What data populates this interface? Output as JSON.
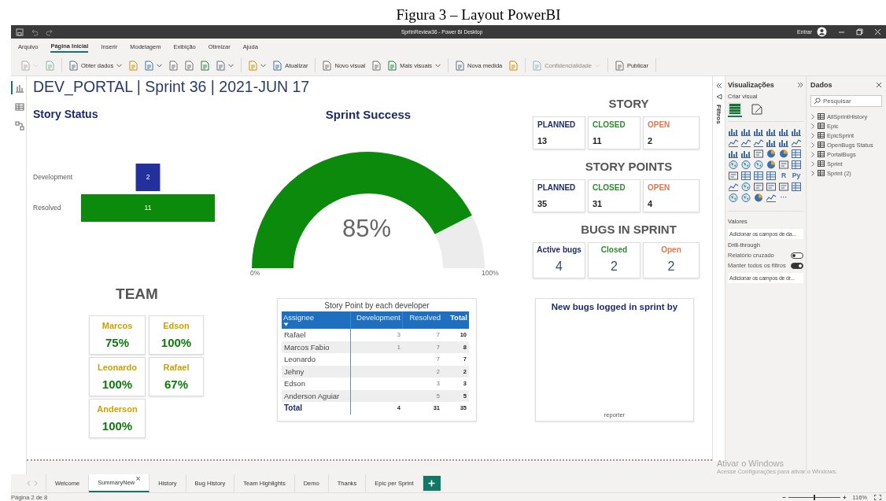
{
  "caption": "Figura 3 – Layout PowerBI",
  "window": {
    "title": "SpritnReview36 - Power BI Desktop",
    "sign_in": "Entrar"
  },
  "ribbon_tabs": [
    {
      "label": "Arquivo",
      "selected": false
    },
    {
      "label": "Página Inicial",
      "selected": true
    },
    {
      "label": "Inserir",
      "selected": false
    },
    {
      "label": "Modelagem",
      "selected": false
    },
    {
      "label": "Exibição",
      "selected": false
    },
    {
      "label": "Otimizar",
      "selected": false
    },
    {
      "label": "Ajuda",
      "selected": false
    }
  ],
  "toolbar": [
    [
      {
        "dropdown": true,
        "disabled": true
      },
      {
        "dropdown": false,
        "disabled": true
      }
    ],
    [
      {
        "label": "Obter dados",
        "dropdown": true,
        "disabled": false
      },
      {
        "dropdown": false,
        "disabled": false
      },
      {
        "dropdown": true,
        "disabled": false
      },
      {
        "dropdown": false,
        "disabled": false
      },
      {
        "dropdown": false,
        "disabled": false
      },
      {
        "dropdown": false,
        "disabled": false
      },
      {
        "dropdown": true,
        "disabled": false
      }
    ],
    [
      {
        "dropdown": true,
        "disabled": false
      },
      {
        "label": "Atualizar",
        "dropdown": false,
        "disabled": false
      }
    ],
    [
      {
        "label": "Novo visual",
        "dropdown": false,
        "disabled": false
      },
      {
        "dropdown": false,
        "disabled": false
      },
      {
        "label": "Mais visuais",
        "dropdown": true,
        "disabled": false
      }
    ],
    [
      {
        "label": "Nova medida",
        "dropdown": false,
        "disabled": false
      },
      {
        "dropdown": false,
        "disabled": false
      }
    ],
    [
      {
        "label": "Confidencialidade",
        "dropdown": true,
        "disabled": true
      }
    ],
    [
      {
        "label": "Publicar",
        "dropdown": false,
        "disabled": false
      }
    ]
  ],
  "left_rail": [
    {
      "selected": true
    },
    {
      "selected": false
    },
    {
      "selected": false
    }
  ],
  "report": {
    "title": "DEV_PORTAL | Sprint 36 | 2021-JUN 17",
    "story_status": {
      "title": "Story Status",
      "bars": [
        {
          "label": "Development",
          "value": "2",
          "color": "#22319b"
        },
        {
          "label": "Resolved",
          "value": "11",
          "color": "#0b8a0b"
        }
      ]
    },
    "sprint_success": {
      "title": "Sprint Success",
      "reading": "85%",
      "min_label": "0%",
      "max_label": "100%"
    },
    "kpi_groups": [
      {
        "title": "STORY",
        "cards": [
          {
            "label": "PLANNED",
            "value": "13",
            "kind": "planned"
          },
          {
            "label": "CLOSED",
            "value": "11",
            "kind": "closed"
          },
          {
            "label": "OPEN",
            "value": "2",
            "kind": "open"
          }
        ]
      },
      {
        "title": "STORY POINTS",
        "cards": [
          {
            "label": "PLANNED",
            "value": "35",
            "kind": "planned"
          },
          {
            "label": "CLOSED",
            "value": "31",
            "kind": "closed"
          },
          {
            "label": "OPEN",
            "value": "4",
            "kind": "open"
          }
        ]
      },
      {
        "title": "BUGS IN SPRINT",
        "cards": [
          {
            "label": "Active bugs",
            "value": "4",
            "kind": "planned"
          },
          {
            "label": "Closed",
            "value": "2",
            "kind": "closed"
          },
          {
            "label": "Open",
            "value": "2",
            "kind": "open"
          }
        ]
      }
    ],
    "team": {
      "title": "TEAM",
      "members": [
        {
          "name": "Marcos",
          "value": "75%"
        },
        {
          "name": "Edson",
          "value": "100%"
        },
        {
          "name": "Leonardo",
          "value": "100%"
        },
        {
          "name": "Rafael",
          "value": "67%"
        },
        {
          "name": "Anderson",
          "value": "100%"
        }
      ]
    },
    "table": {
      "title": "Story Point by each developer",
      "columns": [
        {
          "label": "Assignee",
          "sorted": true
        },
        {
          "label": "Development",
          "sorted": false
        },
        {
          "label": "Resolved",
          "sorted": false
        },
        {
          "label": "Total",
          "sorted": false
        }
      ],
      "rows": [
        {
          "assignee": "Rafael",
          "development": "3",
          "resolved": "7",
          "total": "10"
        },
        {
          "assignee": "Marcos Fabio",
          "development": "1",
          "resolved": "7",
          "total": "8"
        },
        {
          "assignee": "Leonardo",
          "resolved": "7",
          "total": "7"
        },
        {
          "assignee": "Jehny",
          "resolved": "2",
          "total": "2"
        },
        {
          "assignee": "Edson",
          "resolved": "3",
          "total": "3"
        },
        {
          "assignee": "Anderson Aguiar",
          "resolved": "5",
          "total": "5"
        }
      ],
      "total_row": {
        "assignee": "Total",
        "development": "4",
        "resolved": "31",
        "total": "35"
      }
    },
    "new_bugs": {
      "title": "New bugs logged in sprint by",
      "axis_label": "reporter"
    }
  },
  "filters_pane": {
    "label": "Filtros"
  },
  "visualizations": {
    "title": "Visualizações",
    "subtitle": "Criar visual",
    "build_tabs": [
      {
        "selected": true
      },
      {
        "selected": false
      }
    ],
    "visual_types": [
      {
        "kind": "bar"
      },
      {
        "kind": "bar"
      },
      {
        "kind": "bar"
      },
      {
        "kind": "bar"
      },
      {
        "kind": "bar"
      },
      {
        "kind": "bar"
      },
      {
        "kind": "line"
      },
      {
        "kind": "line"
      },
      {
        "kind": "line"
      },
      {
        "kind": "bar"
      },
      {
        "kind": "bar"
      },
      {
        "kind": "line"
      },
      {
        "kind": "bar"
      },
      {
        "kind": "bar"
      },
      {
        "kind": "card"
      },
      {
        "kind": "pie"
      },
      {
        "kind": "pie"
      },
      {
        "kind": "table"
      },
      {
        "kind": "map"
      },
      {
        "kind": "map"
      },
      {
        "kind": "map"
      },
      {
        "kind": "pie"
      },
      {
        "kind": "card"
      },
      {
        "kind": "table"
      },
      {
        "kind": "card"
      },
      {
        "kind": "table"
      },
      {
        "kind": "table"
      },
      {
        "kind": "table"
      },
      {
        "kind": "text",
        "label": "R"
      },
      {
        "kind": "text",
        "label": "Py"
      },
      {
        "kind": "line"
      },
      {
        "kind": "map"
      },
      {
        "kind": "card"
      },
      {
        "kind": "card"
      },
      {
        "kind": "card"
      },
      {
        "kind": "table"
      },
      {
        "kind": "map"
      },
      {
        "kind": "map"
      },
      {
        "kind": "pie"
      },
      {
        "kind": "line"
      },
      {
        "kind": "text",
        "label": "···"
      }
    ],
    "values_label": "Valores",
    "values_field": "Adicionar os campos de da...",
    "drill_label": "Drill-through",
    "toggles": [
      {
        "label": "Relatório cruzado",
        "on": false
      },
      {
        "label": "Manter todos os filtros",
        "on": true
      }
    ],
    "drill_field": "Adicionar os campos de dr..."
  },
  "data_pane": {
    "title": "Dados",
    "search": {
      "placeholder": "Pesquisar"
    },
    "tables": [
      {
        "name": "AllSprintHistory",
        "expanded": false
      },
      {
        "name": "Epic",
        "expanded": false
      },
      {
        "name": "EpicSprint",
        "expanded": false
      },
      {
        "name": "OpenBugs Status",
        "expanded": false
      },
      {
        "name": "PortalBugs",
        "expanded": false
      },
      {
        "name": "Sprint",
        "expanded": false
      },
      {
        "name": "Sprint (2)",
        "expanded": false
      }
    ]
  },
  "page_tabs": [
    {
      "label": "Welcome",
      "selected": false
    },
    {
      "label": "SummaryNew",
      "selected": true
    },
    {
      "label": "History",
      "selected": false
    },
    {
      "label": "Bug History",
      "selected": false
    },
    {
      "label": "Team Highlights",
      "selected": false
    },
    {
      "label": "Demo",
      "selected": false
    },
    {
      "label": "Thanks",
      "selected": false
    },
    {
      "label": "Epic per Sprint",
      "selected": false
    }
  ],
  "status_bar": {
    "page": "Página 2 de 8",
    "zoom": "116%",
    "zoom_slider": {
      "level": 0.5
    }
  },
  "windows_notice": {
    "title": "Ativar o Windows",
    "text": "Acesse Configurações para ativar o Windows."
  }
}
